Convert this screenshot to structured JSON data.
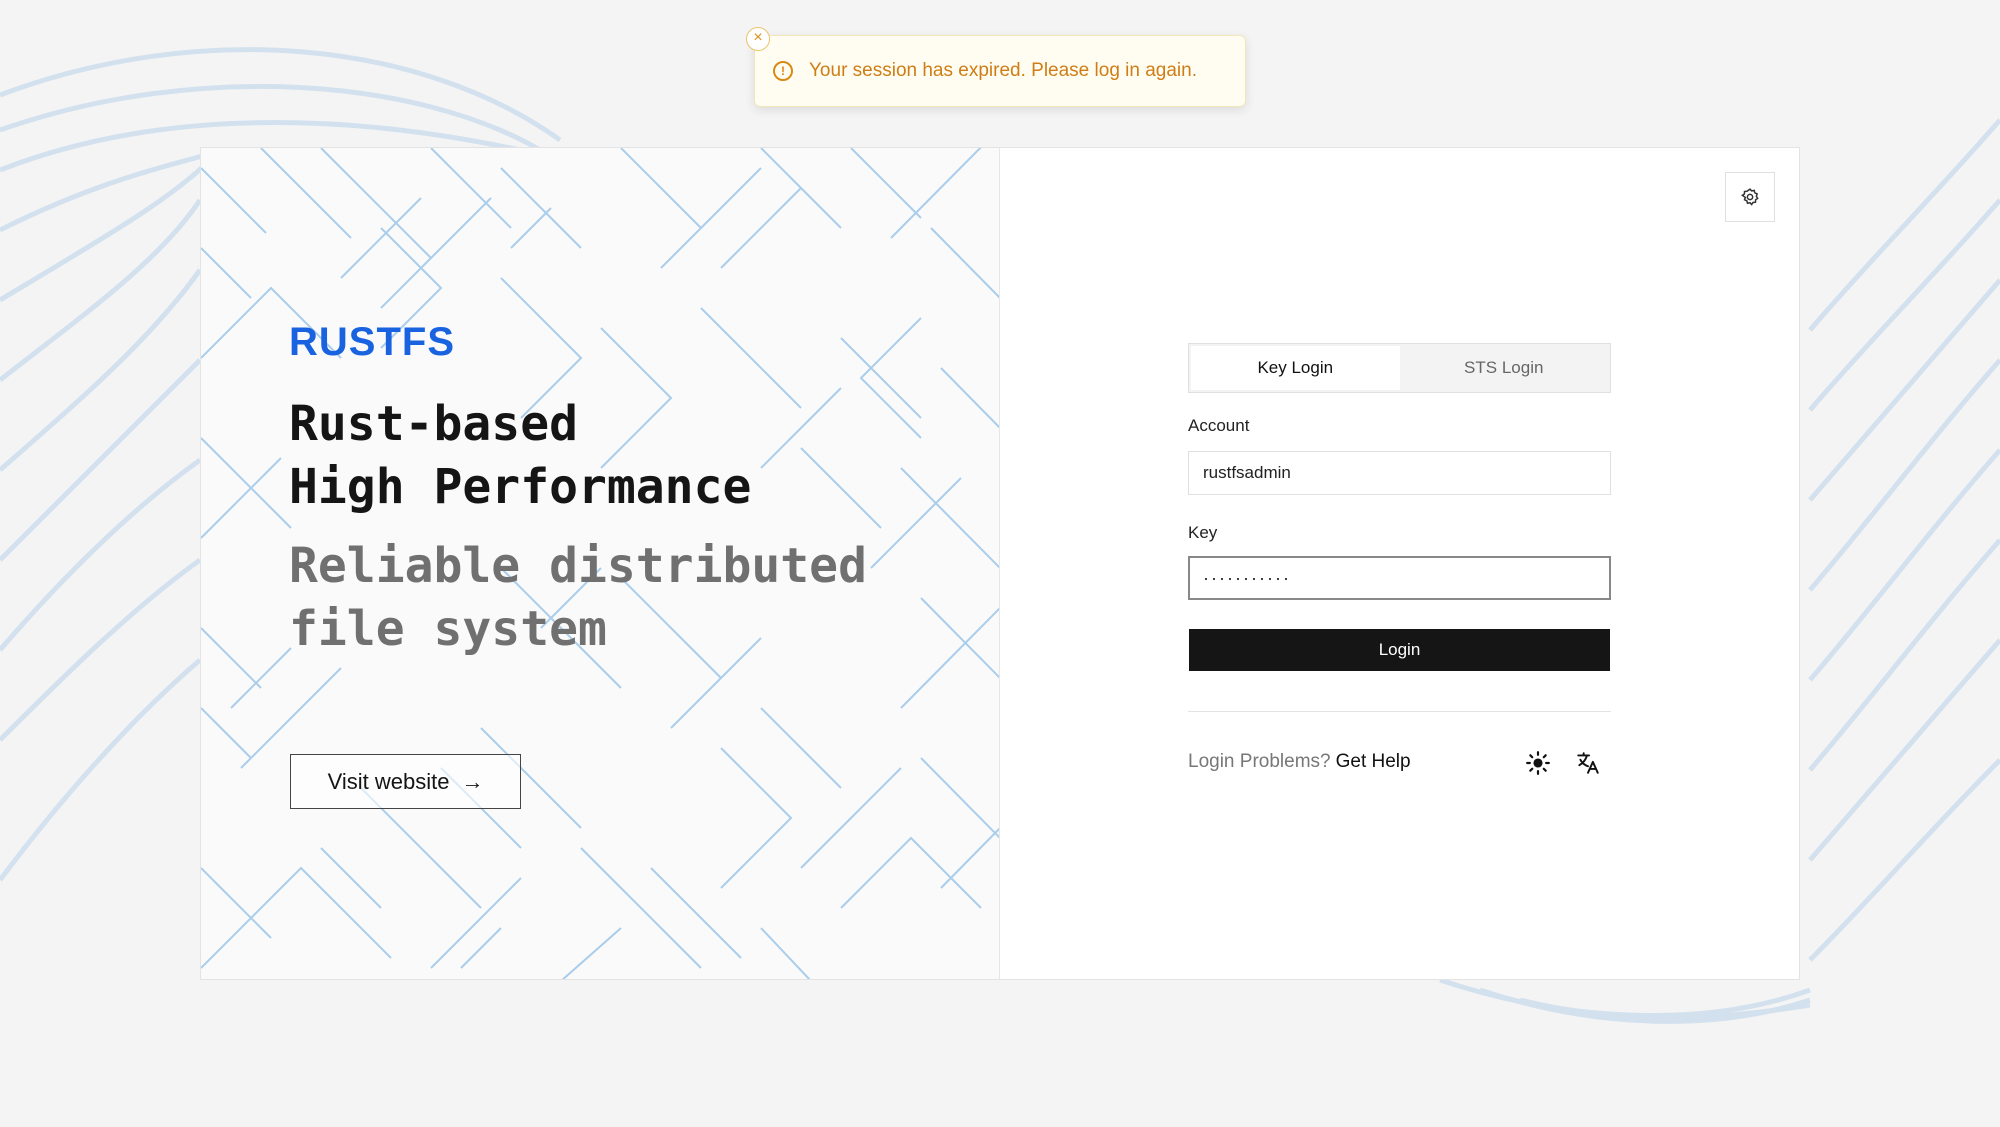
{
  "toast": {
    "message": "Your session has expired. Please log in again.",
    "close_glyph": "×",
    "icon_glyph": "!",
    "icon": "alert-circle-icon",
    "color": "#cf7d14"
  },
  "brand": {
    "logo_text": "RUSTFS",
    "logo_color": "#1a63e0"
  },
  "hero": {
    "headline_line1": "Rust-based",
    "headline_line2": "High Performance",
    "subline_line1": "Reliable distributed",
    "subline_line2": "file system"
  },
  "visit_button": {
    "label": "Visit website",
    "arrow": "→"
  },
  "settings": {
    "icon": "gear-icon"
  },
  "tabs": [
    {
      "label": "Key Login",
      "active": true
    },
    {
      "label": "STS Login",
      "active": false
    }
  ],
  "form": {
    "account_label": "Account",
    "account_value": "rustfsadmin",
    "key_label": "Key",
    "key_value": "···········",
    "login_label": "Login"
  },
  "help": {
    "question": "Login Problems?",
    "link": "Get Help"
  },
  "footer_icons": {
    "theme": "sun-icon",
    "language": "translate-icon"
  }
}
